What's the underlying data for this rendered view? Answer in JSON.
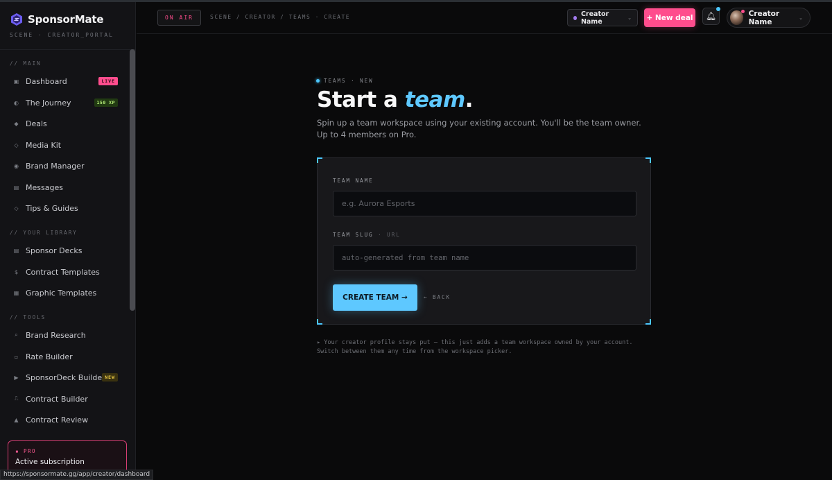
{
  "brand": {
    "name": "SponsorMate",
    "subtitle": "SCENE · CREATOR_PORTAL"
  },
  "sidebar": {
    "sections": {
      "main": "// MAIN",
      "library": "// YOUR LIBRARY",
      "tools": "// TOOLS"
    },
    "main_items": [
      {
        "label": "Dashboard",
        "icon": "▣",
        "icon_name": "dashboard-icon",
        "badge": "LIVE"
      },
      {
        "label": "The Journey",
        "icon": "◐",
        "icon_name": "journey-icon",
        "badge": "150 XP"
      },
      {
        "label": "Deals",
        "icon": "◆",
        "icon_name": "deals-icon"
      },
      {
        "label": "Media Kit",
        "icon": "◇",
        "icon_name": "media-kit-icon"
      },
      {
        "label": "Brand Manager",
        "icon": "◉",
        "icon_name": "brand-manager-icon"
      },
      {
        "label": "Messages",
        "icon": "▤",
        "icon_name": "messages-icon"
      },
      {
        "label": "Tips & Guides",
        "icon": "◇",
        "icon_name": "tips-icon"
      }
    ],
    "library_items": [
      {
        "label": "Sponsor Decks",
        "icon": "▤",
        "icon_name": "sponsor-decks-icon"
      },
      {
        "label": "Contract Templates",
        "icon": "$",
        "icon_name": "contract-templates-icon"
      },
      {
        "label": "Graphic Templates",
        "icon": "▦",
        "icon_name": "graphic-templates-icon"
      }
    ],
    "tools_items": [
      {
        "label": "Brand Research",
        "icon": "⌕",
        "icon_name": "brand-research-icon"
      },
      {
        "label": "Rate Builder",
        "icon": "▫",
        "icon_name": "rate-builder-icon"
      },
      {
        "label": "SponsorDeck Builder",
        "icon": "▶",
        "icon_name": "sponsordeck-builder-icon",
        "badge": "NEW"
      },
      {
        "label": "Contract Builder",
        "icon": "⎍",
        "icon_name": "contract-builder-icon"
      },
      {
        "label": "Contract Review",
        "icon": "▲",
        "icon_name": "contract-review-icon"
      }
    ],
    "pro": {
      "tag": "▪ PRO",
      "title": "Active subscription"
    }
  },
  "status_url": "https://sponsormate.gg/app/creator/dashboard",
  "topbar": {
    "on_air": "ON AIR",
    "breadcrumb": "SCENE / CREATOR / TEAMS · CREATE",
    "account_select": "Creator Name",
    "new_deal": "+ New deal",
    "user_name": "Creator Name"
  },
  "main": {
    "eyebrow": "TEAMS · NEW",
    "headline_prefix": "Start a ",
    "headline_accent": "team",
    "headline_suffix": ".",
    "lead": "Spin up a team workspace using your existing account. You'll be the team owner. Up to 4 members on Pro.",
    "form": {
      "team_name_label": "TEAM NAME",
      "team_name_placeholder": "e.g. Aurora Esports",
      "team_slug_label": "TEAM SLUG",
      "team_slug_label_muted": "· URL",
      "team_slug_placeholder": "auto-generated from team name",
      "create_button": "CREATE TEAM →",
      "back": "← BACK"
    },
    "footnote": "▸ Your creator profile stays put — this just adds a team workspace owned by your account. Switch between them any time from the workspace picker."
  },
  "colors": {
    "accent_pink": "#ff4d8d",
    "accent_cyan": "#5ec8ff",
    "background": "#0a0a0b"
  }
}
